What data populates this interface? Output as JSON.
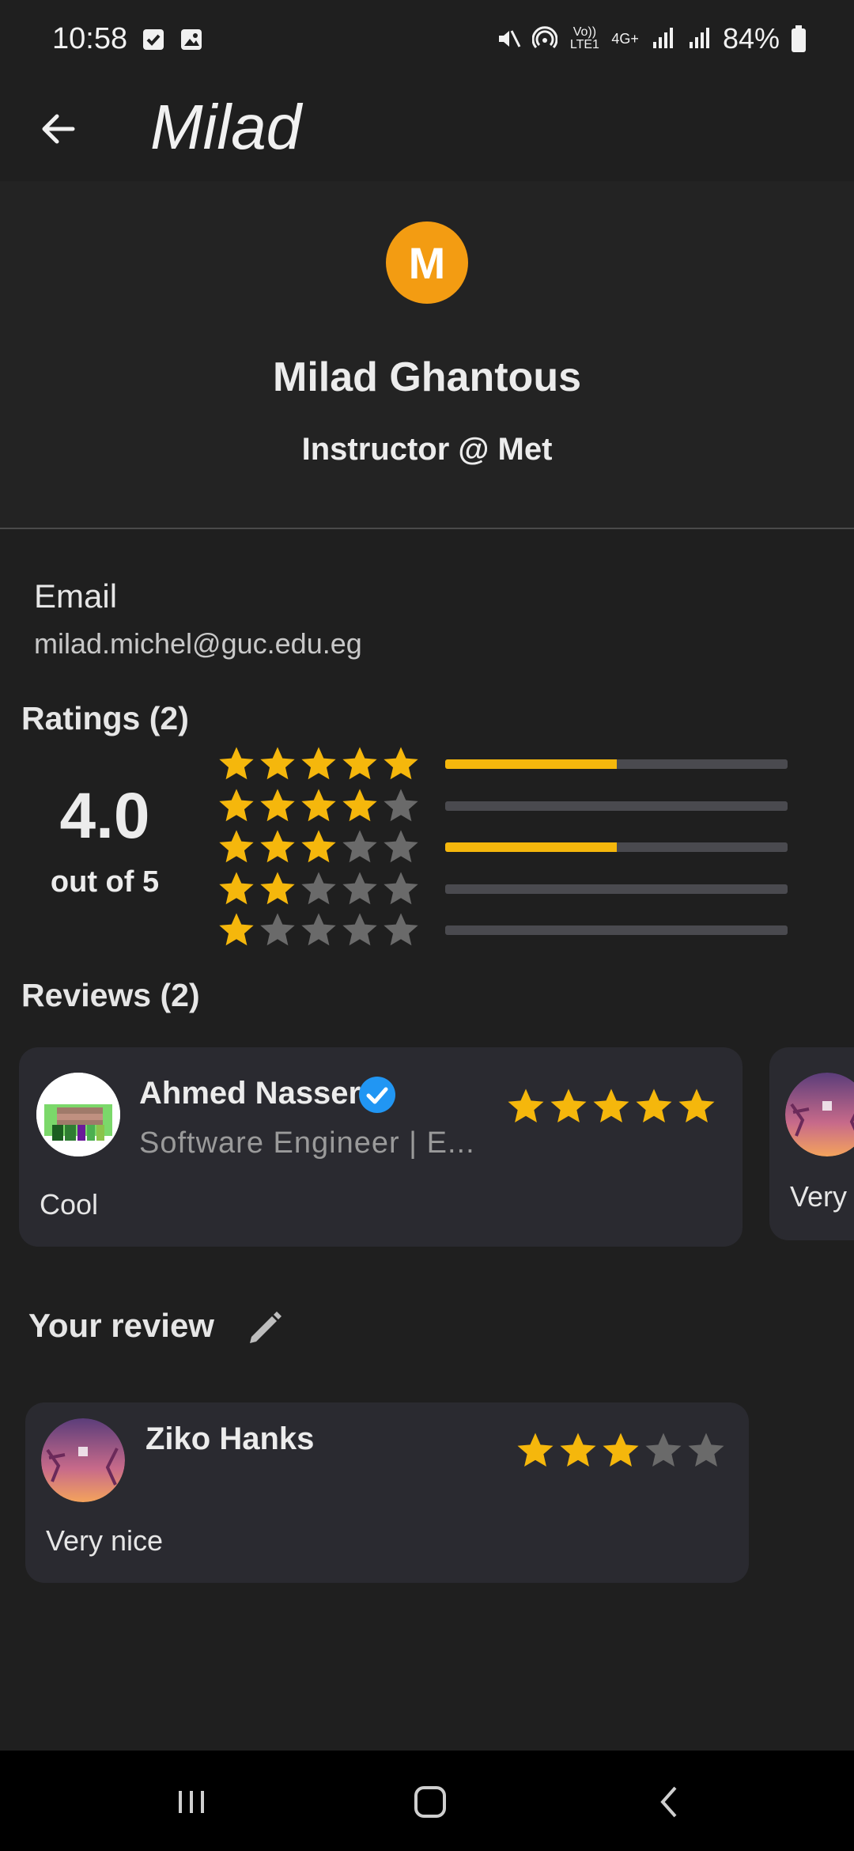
{
  "status_bar": {
    "time": "10:58",
    "battery": "84%",
    "network": "4G+",
    "volte": "Vo)) LTE1"
  },
  "app_bar": {
    "title": "Milad"
  },
  "profile": {
    "initial": "M",
    "name": "Milad Ghantous",
    "role": "Instructor @ Met",
    "avatar_color": "#f39c12"
  },
  "contact": {
    "email_label": "Email",
    "email_value": "milad.michel@guc.edu.eg"
  },
  "ratings": {
    "title": "Ratings (2)",
    "average": "4.0",
    "out_of": "out of 5",
    "accent": "#f5b70c",
    "rows": [
      {
        "stars": 5,
        "fraction": 0.5
      },
      {
        "stars": 4,
        "fraction": 0
      },
      {
        "stars": 3,
        "fraction": 0.5
      },
      {
        "stars": 2,
        "fraction": 0
      },
      {
        "stars": 1,
        "fraction": 0
      }
    ]
  },
  "reviews": {
    "title": "Reviews (2)",
    "items": [
      {
        "name": "Ahmed Nasser",
        "subtitle": "Software Engineer | E...",
        "stars": 5,
        "text": "Cool",
        "verified": true
      },
      {
        "text": "Very"
      }
    ]
  },
  "your_review": {
    "title": "Your review",
    "name": "Ziko Hanks",
    "stars": 3,
    "text": "Very nice"
  }
}
